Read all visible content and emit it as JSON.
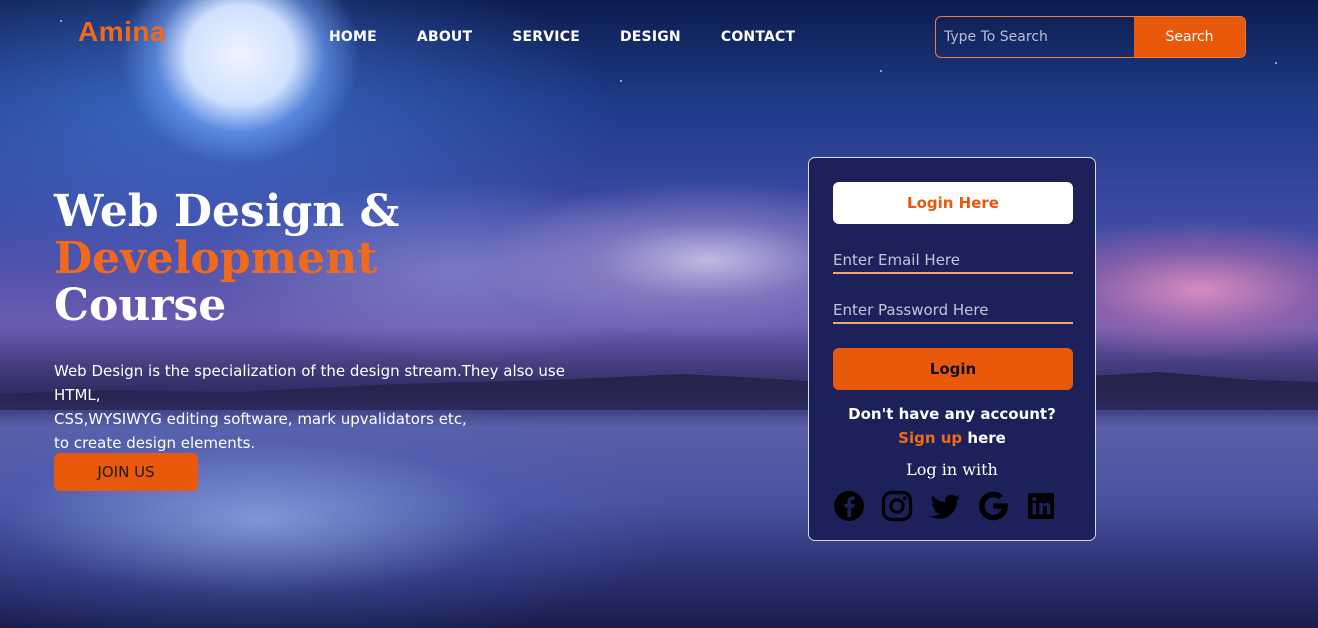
{
  "brand": {
    "logo": "Amina",
    "accent_color": "#e8590c"
  },
  "nav": {
    "items": [
      "HOME",
      "ABOUT",
      "SERVICE",
      "DESIGN",
      "CONTACT"
    ]
  },
  "search": {
    "placeholder": "Type To Search",
    "button_label": "Search"
  },
  "hero": {
    "title_line1": "Web Design &",
    "title_line2": "Development",
    "title_line3": "Course",
    "description_lines": [
      "Web Design is the specialization of the design stream.They also use HTML,",
      "CSS,WYSIWYG editing software, mark upvalidators etc,",
      "to create design elements."
    ],
    "cta_label": "JOIN US"
  },
  "login": {
    "title": "Login Here",
    "email_placeholder": "Enter Email Here",
    "password_placeholder": "Enter Password Here",
    "button_label": "Login",
    "no_account_text": "Don't have any account?",
    "signup_link": "Sign up",
    "signup_suffix": " here",
    "login_with_text": "Log in with",
    "social_icons": [
      "facebook-icon",
      "instagram-icon",
      "twitter-icon",
      "google-icon",
      "linkedin-icon"
    ]
  }
}
